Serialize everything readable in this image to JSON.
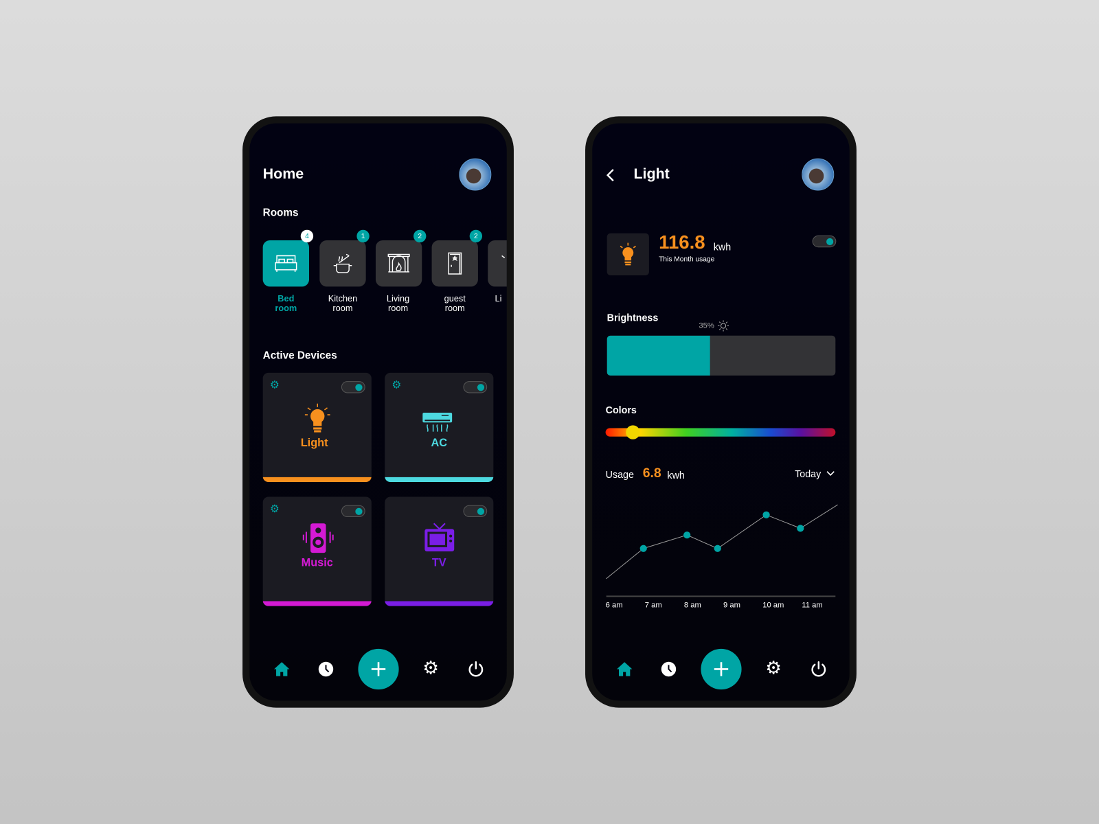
{
  "colors": {
    "accent": "#00a5a5",
    "light": "#f7901e",
    "ac": "#4dd9e0",
    "music": "#d41ad4",
    "tv": "#7a1ee6"
  },
  "home": {
    "title": "Home",
    "rooms_heading": "Rooms",
    "rooms": [
      {
        "line1": "Bed",
        "line2": "room",
        "count": "4",
        "icon": "bed-icon",
        "active": true
      },
      {
        "line1": "Kitchen",
        "line2": "room",
        "count": "1",
        "icon": "pot-icon"
      },
      {
        "line1": "Living",
        "line2": "room",
        "count": "2",
        "icon": "fireplace-icon"
      },
      {
        "line1": "guest",
        "line2": "room",
        "count": "2",
        "icon": "door-icon"
      },
      {
        "line1": "Li",
        "line2": "",
        "icon": "lamp-icon"
      }
    ],
    "devices_heading": "Active Devices",
    "devices": [
      {
        "name": "Light",
        "icon": "bulb-icon",
        "on": true
      },
      {
        "name": "AC",
        "icon": "ac-icon",
        "on": true
      },
      {
        "name": "Music",
        "icon": "speaker-icon",
        "on": true
      },
      {
        "name": "TV",
        "icon": "tv-icon",
        "on": true
      }
    ]
  },
  "light": {
    "title": "Light",
    "usage_value": "116.8",
    "usage_unit": "kwh",
    "usage_caption": "This Month usage",
    "power_on": true,
    "brightness_label": "Brightness",
    "brightness_text": "35%",
    "brightness_fill": 0.45,
    "colors_label": "Colors",
    "color_position": 0.12,
    "usage_label": "Usage",
    "today_value": "6.8",
    "today_unit": "kwh",
    "period": "Today"
  },
  "chart_data": {
    "type": "line",
    "x_tick_labels": [
      "6 am",
      "7 am",
      "8 am",
      "9 am",
      "10 am",
      "11 am"
    ],
    "x": [
      5.8,
      6.75,
      7.86,
      8.64,
      9.88,
      10.75,
      11.7
    ],
    "y": [
      0.5,
      1.4,
      1.8,
      1.4,
      2.4,
      2.0,
      2.7
    ],
    "markers": [
      false,
      true,
      true,
      true,
      true,
      true,
      false
    ],
    "grid": false
  },
  "nav": [
    "home-icon",
    "clock-icon",
    "plus-icon",
    "gear-icon",
    "power-icon"
  ]
}
